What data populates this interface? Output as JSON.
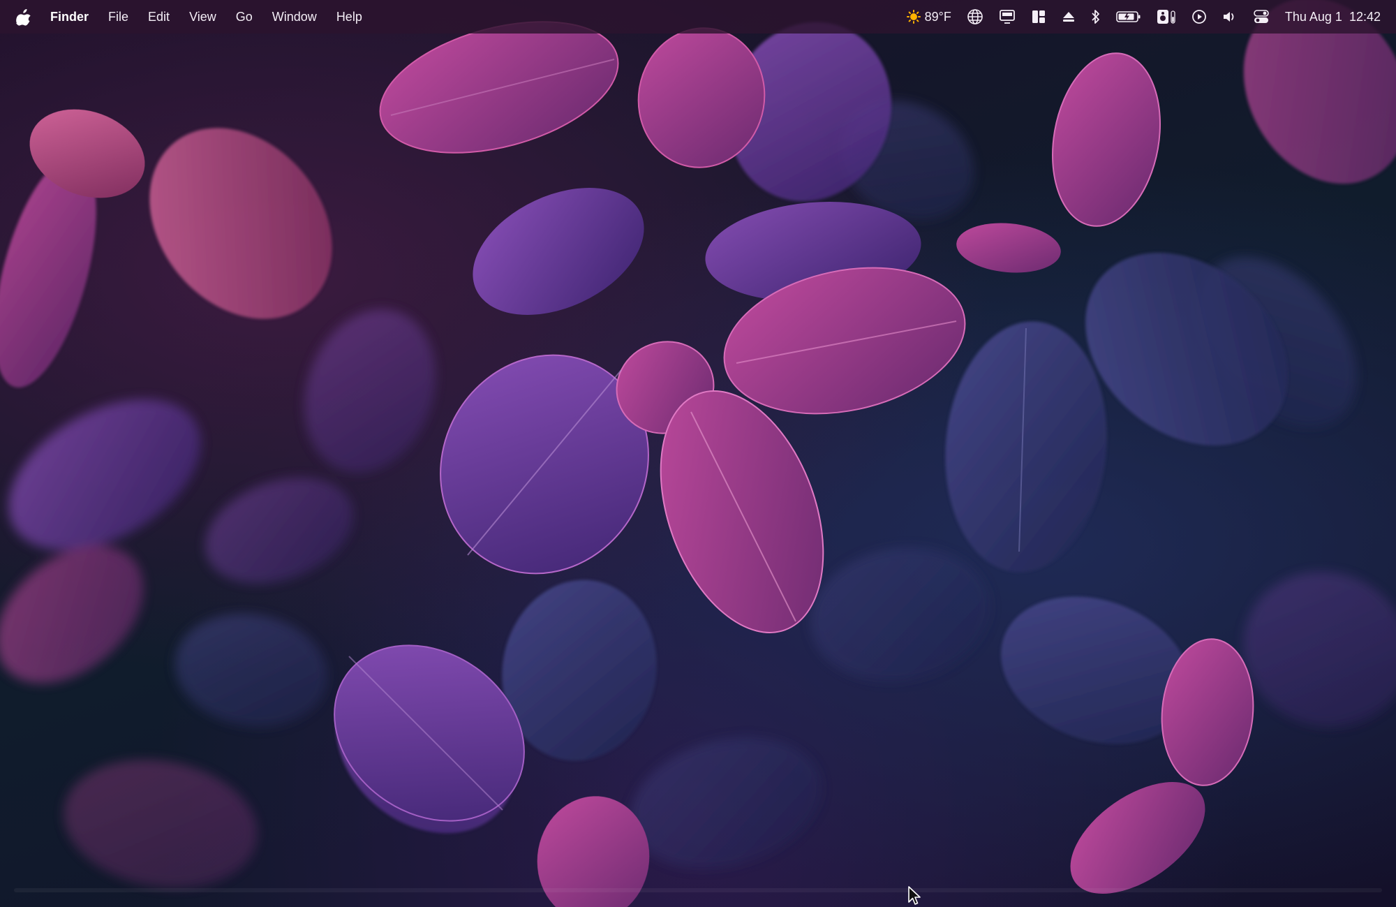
{
  "menubar": {
    "app_name": "Finder",
    "menus": [
      "File",
      "Edit",
      "View",
      "Go",
      "Window",
      "Help"
    ],
    "weather": {
      "icon": "sun-icon",
      "temperature": "89°F"
    },
    "status_icons": [
      "globe-icon",
      "display-icon",
      "layout-icon",
      "eject-icon",
      "bluetooth-icon",
      "battery-icon",
      "status-app-icon",
      "play-icon",
      "volume-icon",
      "control-center-icon"
    ],
    "date": "Thu Aug 1",
    "time": "12:42"
  },
  "colors": {
    "menubar_bg": "#2c142e",
    "accent_magenta": "#b0368f",
    "accent_violet": "#6a3c9b",
    "sun": "#ffb300"
  }
}
